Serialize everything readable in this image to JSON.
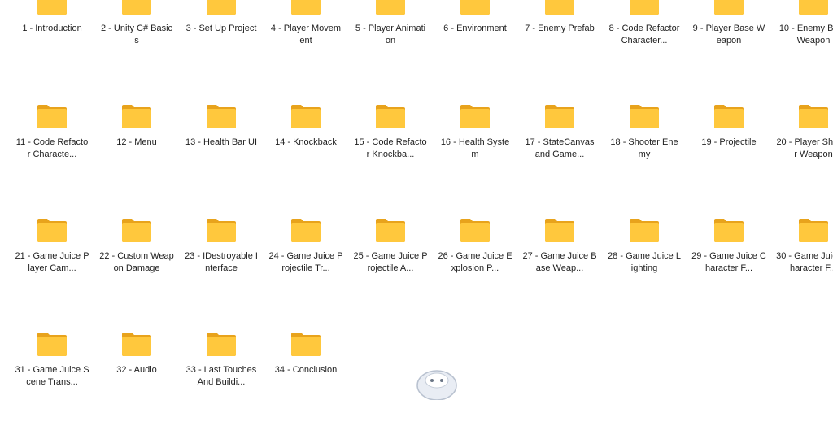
{
  "colors": {
    "folder_front": "#FFC83D",
    "folder_back": "#E8A31C",
    "label_text": "#1f1f1f"
  },
  "folders": [
    {
      "label": "1 - Introduction"
    },
    {
      "label": "2 - Unity C# Basics"
    },
    {
      "label": "3 - Set Up Project"
    },
    {
      "label": "4 - Player Movement"
    },
    {
      "label": "5 - Player Animation"
    },
    {
      "label": "6 - Environment"
    },
    {
      "label": "7 - Enemy Prefab"
    },
    {
      "label": "8 - Code Refactor Character..."
    },
    {
      "label": "9 - Player Base Weapon"
    },
    {
      "label": "10 - Enemy Base Weapon"
    },
    {
      "label": "11 - Code Refactor Characte..."
    },
    {
      "label": "12 - Menu"
    },
    {
      "label": "13 - Health Bar UI"
    },
    {
      "label": "14 - Knockback"
    },
    {
      "label": "15 - Code Refactor Knockba..."
    },
    {
      "label": "16 - Health System"
    },
    {
      "label": "17 - StateCanvas and Game..."
    },
    {
      "label": "18 - Shooter Enemy"
    },
    {
      "label": "19 - Projectile"
    },
    {
      "label": "20 - Player Shooter Weapon"
    },
    {
      "label": "21 - Game Juice Player Cam..."
    },
    {
      "label": "22 - Custom Weapon Damage"
    },
    {
      "label": "23 - IDestroyable Interface"
    },
    {
      "label": "24 - Game Juice Projectile Tr..."
    },
    {
      "label": "25 - Game Juice Projectile A..."
    },
    {
      "label": "26 - Game Juice Explosion P..."
    },
    {
      "label": "27 - Game Juice Base Weap..."
    },
    {
      "label": "28 - Game Juice Lighting"
    },
    {
      "label": "29 - Game Juice Character F..."
    },
    {
      "label": "30 - Game Juice Character F..."
    },
    {
      "label": "31 - Game Juice Scene Trans..."
    },
    {
      "label": "32 - Audio"
    },
    {
      "label": "33 - Last Touches And Buildi..."
    },
    {
      "label": "34 - Conclusion"
    }
  ]
}
